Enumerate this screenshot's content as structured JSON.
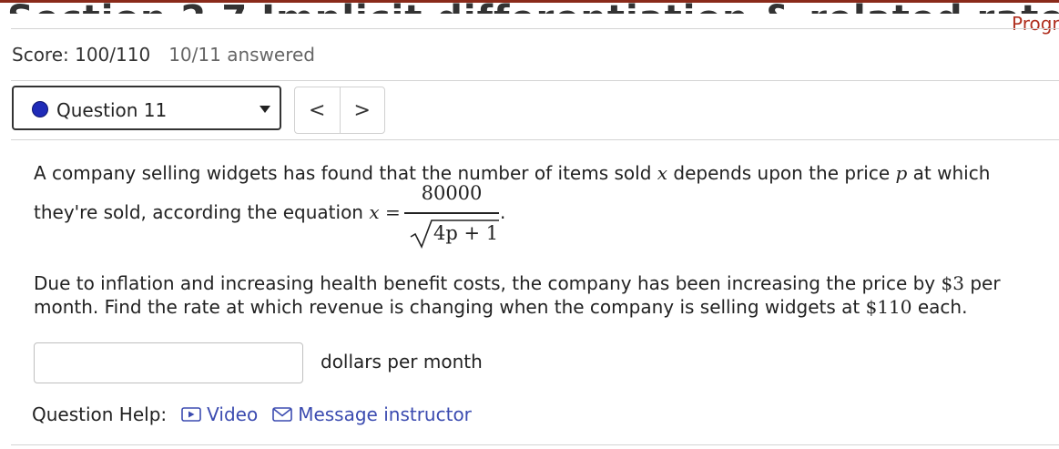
{
  "header": {
    "section_title": "Section 2.7 Implicit differentiation & related rates",
    "progress_link": "Progr"
  },
  "score": {
    "label": "Score: 100/110",
    "answered": "10/11 answered"
  },
  "question_selector": {
    "selected": "Question 11",
    "status_color": "#1f2bb8"
  },
  "nav": {
    "prev": "<",
    "next": ">"
  },
  "problem": {
    "line1_a": "A company selling widgets has found that the number of items sold",
    "var_x": "x",
    "line1_b": "depends upon the price",
    "var_p": "p",
    "line1_c": "at which",
    "line2_a": "they're sold, according the equation",
    "eq_x": "x",
    "eq_sign": "=",
    "numerator": "80000",
    "radicand": "4p + 1",
    "period": ".",
    "para2_line1_a": "Due to inflation and increasing health benefit costs, the company has been increasing the price by",
    "price_increase": "$3",
    "para2_line1_b": "per",
    "para2_line2_a": "month. Find the rate at which revenue is changing when the company is selling widgets at",
    "price_value": "$110",
    "para2_line2_b": "each."
  },
  "answer": {
    "value": "",
    "placeholder": "",
    "units": "dollars per month"
  },
  "help": {
    "label": "Question Help:",
    "video_label": "Video",
    "message_label": "Message instructor",
    "link_color": "#3b4bb0"
  }
}
